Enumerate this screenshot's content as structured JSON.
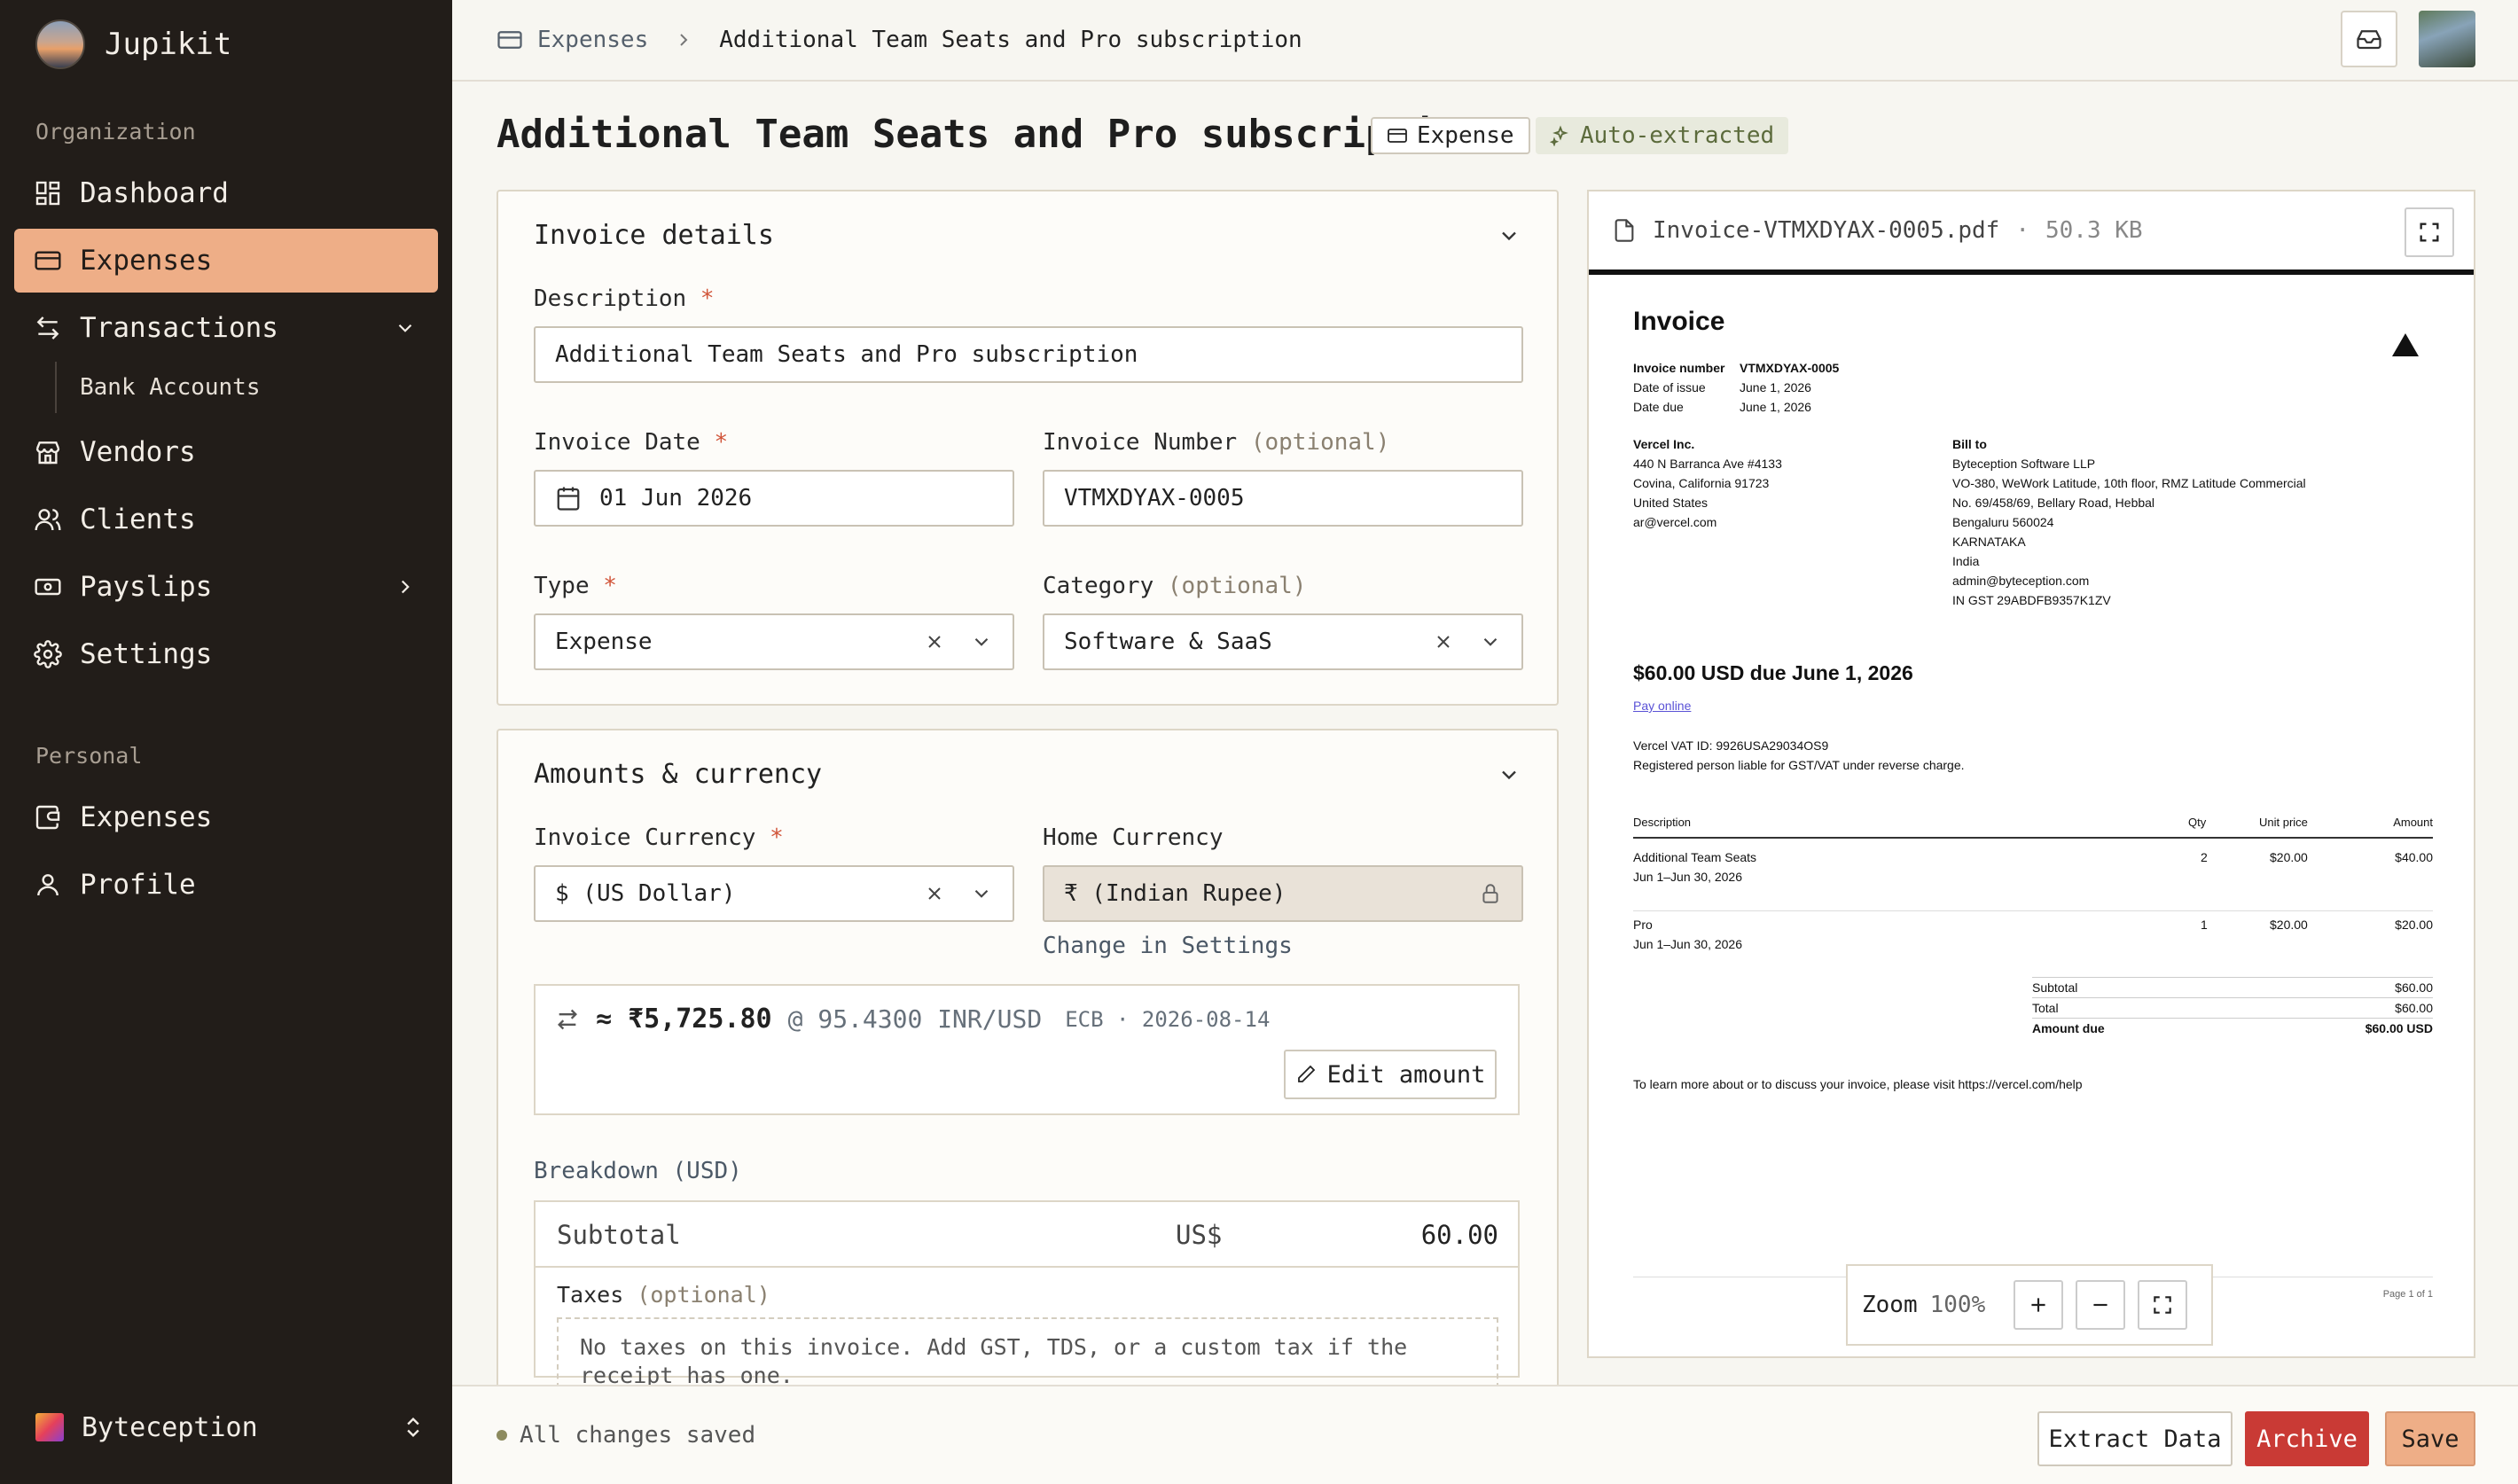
{
  "app": {
    "name": "Jupikit"
  },
  "sidebar": {
    "org_label": "Organization",
    "personal_label": "Personal",
    "items": [
      {
        "label": "Dashboard"
      },
      {
        "label": "Expenses"
      },
      {
        "label": "Transactions"
      },
      {
        "label": "Bank Accounts"
      },
      {
        "label": "Vendors"
      },
      {
        "label": "Clients"
      },
      {
        "label": "Payslips"
      },
      {
        "label": "Settings"
      }
    ],
    "personal_items": [
      {
        "label": "Expenses"
      },
      {
        "label": "Profile"
      }
    ],
    "org_switcher": "Byteception"
  },
  "breadcrumb": {
    "parent": "Expenses",
    "current": "Additional Team Seats and Pro subscription"
  },
  "page": {
    "title": "Additional Team Seats and Pro subscription",
    "badge_type": "Expense",
    "badge_auto": "Auto-extracted"
  },
  "invoice_details": {
    "title": "Invoice details",
    "description_label": "Description",
    "description_value": "Additional Team Seats and Pro subscription",
    "date_label": "Invoice Date",
    "date_value": "01 Jun 2026",
    "number_label": "Invoice Number",
    "number_optional": "(optional)",
    "number_value": "VTMXDYAX-0005",
    "type_label": "Type",
    "type_value": "Expense",
    "category_label": "Category",
    "category_optional": "(optional)",
    "category_value": "Software & SaaS",
    "required_mark": "*"
  },
  "amounts": {
    "title": "Amounts & currency",
    "invoice_currency_label": "Invoice Currency",
    "invoice_currency_value": "$ (US Dollar)",
    "home_currency_label": "Home Currency",
    "home_currency_value": "₹ (Indian Rupee)",
    "change_link": "Change in Settings",
    "fx_approx": "≈",
    "fx_amount": "₹5,725.80",
    "fx_rate": "@ 95.4300 INR/USD",
    "fx_source": "ECB · 2026-08-14",
    "edit_amount": "Edit amount",
    "breakdown_label": "Breakdown (USD)",
    "subtotal_label": "Subtotal",
    "subtotal_currency": "US$",
    "subtotal_value": "60.00",
    "taxes_label": "Taxes",
    "taxes_optional": "(optional)",
    "taxes_empty": "No taxes on this invoice. Add GST, TDS, or a custom tax if the receipt has one."
  },
  "viewer": {
    "filename": "Invoice-VTMXDYAX-0005.pdf",
    "sep": "·",
    "size": "50.3 KB",
    "zoom_label": "Zoom",
    "zoom_value": "100%"
  },
  "pdf": {
    "title": "Invoice",
    "meta": [
      {
        "k": "Invoice number",
        "v": "VTMXDYAX-0005"
      },
      {
        "k": "Date of issue",
        "v": "June 1, 2026"
      },
      {
        "k": "Date due",
        "v": "June 1, 2026"
      }
    ],
    "from_name": "Vercel Inc.",
    "from_lines": [
      "440 N Barranca Ave #4133",
      "Covina, California 91723",
      "United States",
      "ar@vercel.com"
    ],
    "bill_to_label": "Bill to",
    "bill_to_lines": [
      "Byteception Software LLP",
      "VO-380, WeWork Latitude, 10th floor, RMZ Latitude Commercial",
      "No. 69/458/69, Bellary Road, Hebbal",
      "Bengaluru 560024",
      "KARNATAKA",
      "India",
      "admin@byteception.com",
      "IN GST  29ABDFB9357K1ZV"
    ],
    "due_heading": "$60.00 USD due June 1, 2026",
    "pay_online": "Pay online",
    "vat_line": "Vercel VAT ID: 9926USA29034OS9",
    "reverse_line": "Registered person liable for GST/VAT under reverse charge.",
    "cols": [
      "Description",
      "Qty",
      "Unit price",
      "Amount"
    ],
    "rows": [
      {
        "desc": "Additional Team Seats",
        "period": "Jun 1–Jun 30, 2026",
        "qty": "2",
        "unit": "$20.00",
        "amount": "$40.00"
      },
      {
        "desc": "Pro",
        "period": "Jun 1–Jun 30, 2026",
        "qty": "1",
        "unit": "$20.00",
        "amount": "$20.00"
      }
    ],
    "subtotal_k": "Subtotal",
    "subtotal_v": "$60.00",
    "total_k": "Total",
    "total_v": "$60.00",
    "amount_due_k": "Amount due",
    "amount_due_v": "$60.00 USD",
    "footer_note": "To learn more about or to discuss your invoice, please visit https://vercel.com/help",
    "page_label": "Page 1 of 1"
  },
  "footer": {
    "status": "All changes saved",
    "extract": "Extract Data",
    "archive": "Archive",
    "save": "Save"
  },
  "colors": {
    "sidebar_bg": "#221d19",
    "accent": "#eeae87",
    "danger": "#c93a35",
    "required": "#d1553a"
  }
}
